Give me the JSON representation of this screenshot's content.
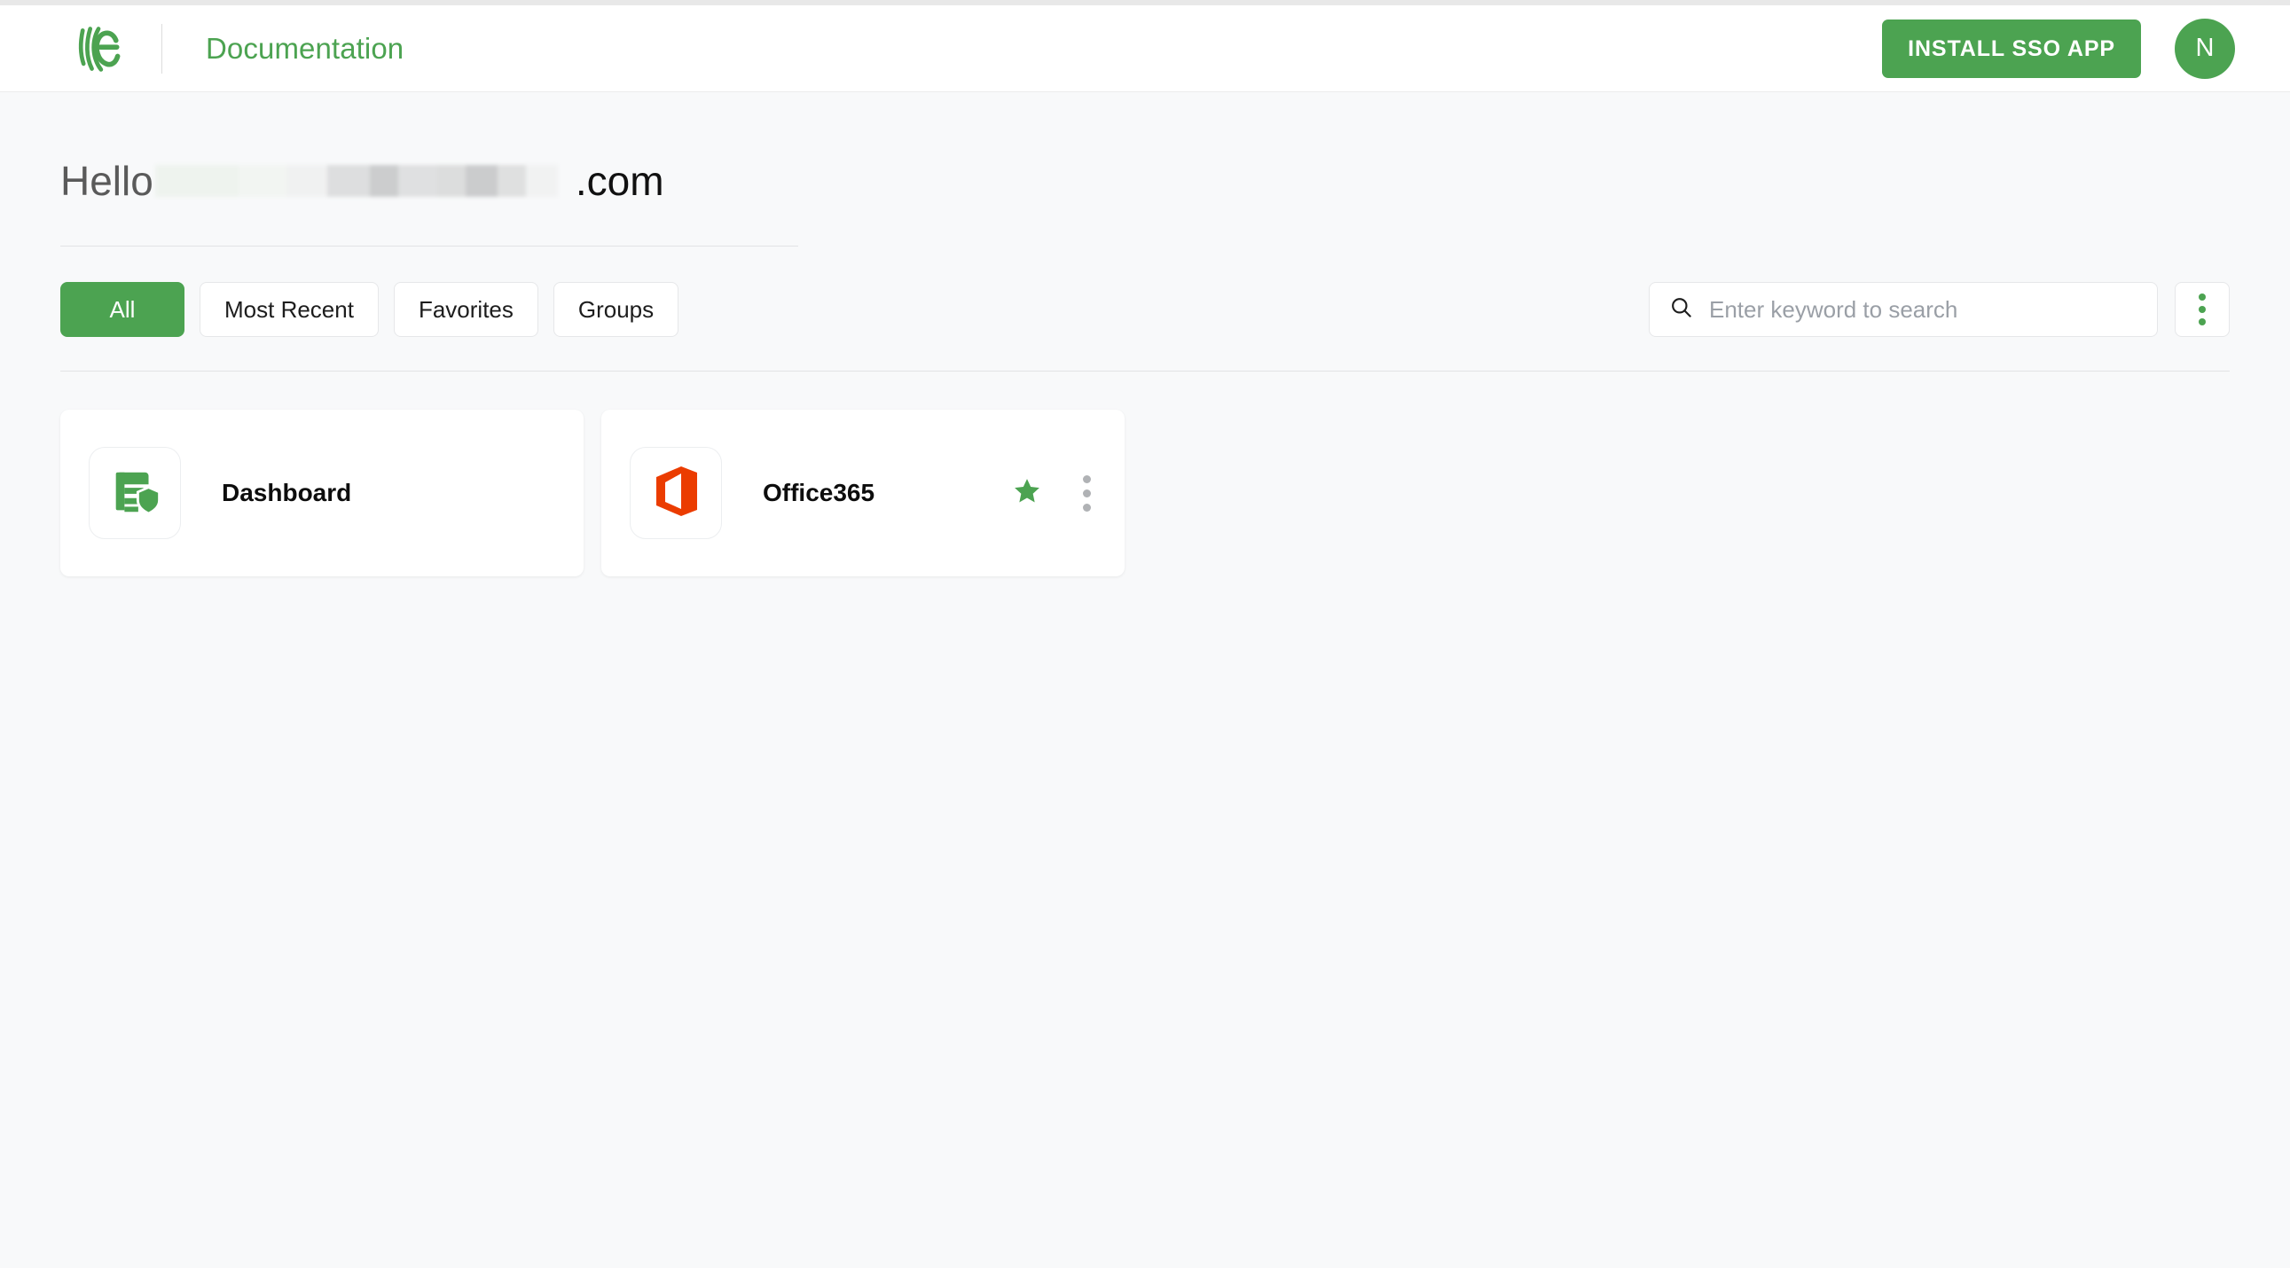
{
  "header": {
    "logo_icon": "miniorange-logo-icon",
    "app_title": "Documentation",
    "install_button_label": "INSTALL SSO APP",
    "avatar_initial": "N",
    "brand_color": "#4ca351"
  },
  "greeting": {
    "hello_text": "Hello",
    "redacted_label": "redacted-username",
    "domain_suffix": ".com"
  },
  "filters": {
    "tabs": [
      {
        "label": "All",
        "active": true
      },
      {
        "label": "Most Recent",
        "active": false
      },
      {
        "label": "Favorites",
        "active": false
      },
      {
        "label": "Groups",
        "active": false
      }
    ],
    "search": {
      "placeholder": "Enter keyword to search",
      "value": "",
      "icon": "search-icon"
    },
    "overflow_menu_icon": "kebab-menu-icon"
  },
  "apps": [
    {
      "name": "Dashboard",
      "icon": "dashboard-shield-icon",
      "favorite": false,
      "has_menu": false
    },
    {
      "name": "Office365",
      "icon": "office365-icon",
      "favorite": true,
      "has_menu": true,
      "star_icon": "star-filled-icon",
      "menu_icon": "kebab-menu-icon"
    }
  ],
  "colors": {
    "accent_green": "#4ca351",
    "office_orange": "#eb3c00",
    "page_background": "#f8f9fa"
  }
}
